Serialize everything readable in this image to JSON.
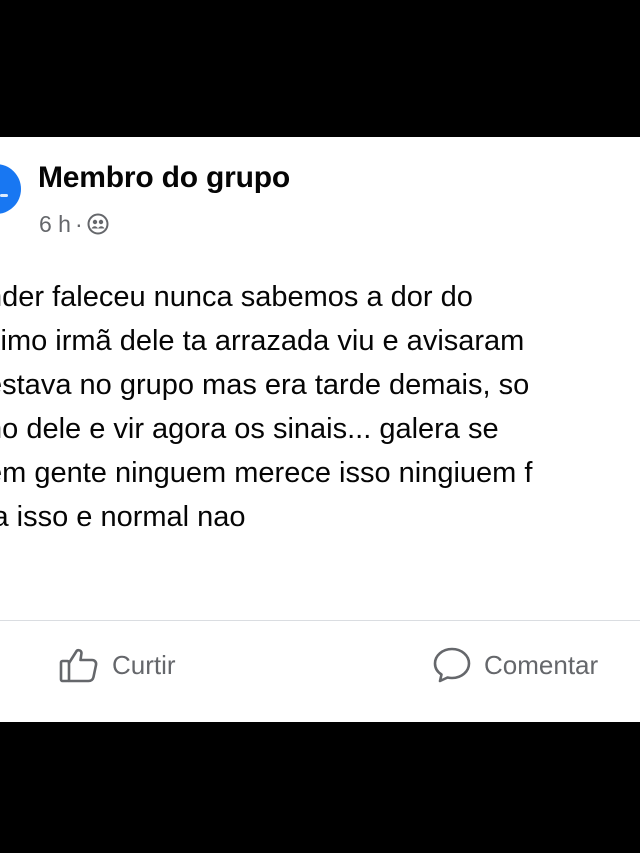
{
  "post": {
    "author": "Membro do grupo",
    "time": "6 h",
    "separator": "·",
    "privacy_icon": "group-privacy-icon",
    "lines": [
      "nder faleceu nunca sabemos a dor do",
      "ximo irmã dele ta arrazada viu e avisaram",
      "estava no grupo mas era tarde demais, so",
      "no dele e vir agora os sinais... galera se",
      "em gente ninguem merece isso ningiuem f",
      "la isso e normal nao"
    ]
  },
  "actions": {
    "like_label": "Curtir",
    "like_icon": "thumbs-up-icon",
    "comment_label": "Comentar",
    "comment_icon": "comment-bubble-icon"
  },
  "colors": {
    "background": "#000000",
    "card": "#ffffff",
    "text_primary": "#050505",
    "text_secondary": "#65676b",
    "avatar_accent": "#1877f2",
    "divider": "#dadde1"
  }
}
